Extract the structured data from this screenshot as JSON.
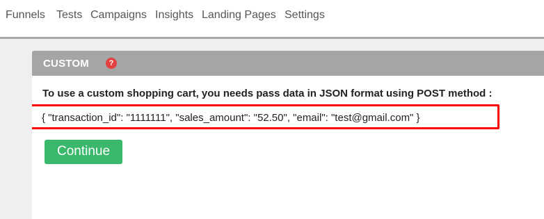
{
  "nav": {
    "items": [
      "Funnels",
      "Tests",
      "Campaigns",
      "Insights",
      "Landing Pages",
      "Settings"
    ]
  },
  "panel": {
    "title": "CUSTOM",
    "help_icon": "?",
    "instructions": "To use a custom shopping cart, you needs pass data in JSON format using POST method :",
    "json_example": "{ \"transaction_id\": \"1111111\", \"sales_amount\": \"52.50\", \"email\": \"test@gmail.com\" }",
    "continue_label": "Continue"
  },
  "colors": {
    "header_bg": "#a5a5a5",
    "help_icon": "#e2413f",
    "highlight_border": "#ff0000",
    "button_green": "#3ab86b",
    "nav_text": "#555555"
  }
}
